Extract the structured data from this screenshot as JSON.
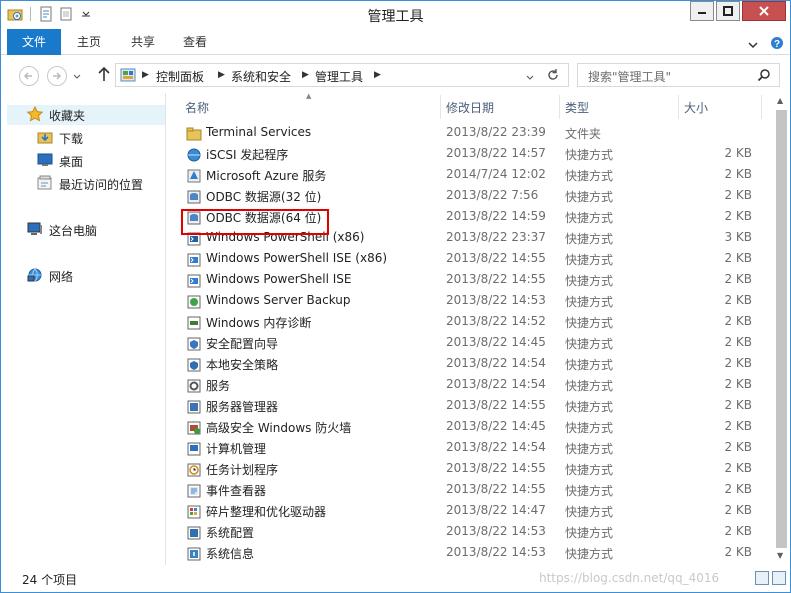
{
  "window": {
    "title": "管理工具"
  },
  "ribbon": {
    "tabs": [
      "文件",
      "主页",
      "共享",
      "查看"
    ]
  },
  "address": {
    "path": [
      "控制面板",
      "系统和安全",
      "管理工具"
    ],
    "search_placeholder": "搜索\"管理工具\""
  },
  "nav": {
    "favorites": "收藏夹",
    "downloads": "下载",
    "desktop": "桌面",
    "recent": "最近访问的位置",
    "this_pc": "这台电脑",
    "network": "网络"
  },
  "columns": {
    "name": "名称",
    "date": "修改日期",
    "type": "类型",
    "size": "大小"
  },
  "files": [
    {
      "name": "Terminal Services",
      "date": "2013/8/22 23:39",
      "type": "文件夹",
      "size": "",
      "icon": "folder-icon"
    },
    {
      "name": "iSCSI 发起程序",
      "date": "2013/8/22 14:57",
      "type": "快捷方式",
      "size": "2 KB",
      "icon": "iscsi-icon"
    },
    {
      "name": "Microsoft Azure 服务",
      "date": "2014/7/24 12:02",
      "type": "快捷方式",
      "size": "2 KB",
      "icon": "azure-icon"
    },
    {
      "name": "ODBC 数据源(32 位)",
      "date": "2013/8/22 7:56",
      "type": "快捷方式",
      "size": "2 KB",
      "icon": "odbc-icon"
    },
    {
      "name": "ODBC 数据源(64 位)",
      "date": "2013/8/22 14:59",
      "type": "快捷方式",
      "size": "2 KB",
      "icon": "odbc-icon"
    },
    {
      "name": "Windows PowerShell (x86)",
      "date": "2013/8/22 23:37",
      "type": "快捷方式",
      "size": "3 KB",
      "icon": "powershell-icon"
    },
    {
      "name": "Windows PowerShell ISE (x86)",
      "date": "2013/8/22 14:55",
      "type": "快捷方式",
      "size": "2 KB",
      "icon": "powershell-ise-icon"
    },
    {
      "name": "Windows PowerShell ISE",
      "date": "2013/8/22 14:55",
      "type": "快捷方式",
      "size": "2 KB",
      "icon": "powershell-ise-icon"
    },
    {
      "name": "Windows Server Backup",
      "date": "2013/8/22 14:53",
      "type": "快捷方式",
      "size": "2 KB",
      "icon": "backup-icon"
    },
    {
      "name": "Windows 内存诊断",
      "date": "2013/8/22 14:52",
      "type": "快捷方式",
      "size": "2 KB",
      "icon": "memory-diagnostic-icon"
    },
    {
      "name": "安全配置向导",
      "date": "2013/8/22 14:45",
      "type": "快捷方式",
      "size": "2 KB",
      "icon": "security-wizard-icon"
    },
    {
      "name": "本地安全策略",
      "date": "2013/8/22 14:54",
      "type": "快捷方式",
      "size": "2 KB",
      "icon": "security-policy-icon"
    },
    {
      "name": "服务",
      "date": "2013/8/22 14:54",
      "type": "快捷方式",
      "size": "2 KB",
      "icon": "services-icon"
    },
    {
      "name": "服务器管理器",
      "date": "2013/8/22 14:55",
      "type": "快捷方式",
      "size": "2 KB",
      "icon": "server-manager-icon"
    },
    {
      "name": "高级安全 Windows 防火墙",
      "date": "2013/8/22 14:45",
      "type": "快捷方式",
      "size": "2 KB",
      "icon": "firewall-icon"
    },
    {
      "name": "计算机管理",
      "date": "2013/8/22 14:54",
      "type": "快捷方式",
      "size": "2 KB",
      "icon": "computer-management-icon"
    },
    {
      "name": "任务计划程序",
      "date": "2013/8/22 14:55",
      "type": "快捷方式",
      "size": "2 KB",
      "icon": "task-scheduler-icon"
    },
    {
      "name": "事件查看器",
      "date": "2013/8/22 14:55",
      "type": "快捷方式",
      "size": "2 KB",
      "icon": "event-viewer-icon"
    },
    {
      "name": "碎片整理和优化驱动器",
      "date": "2013/8/22 14:47",
      "type": "快捷方式",
      "size": "2 KB",
      "icon": "defrag-icon"
    },
    {
      "name": "系统配置",
      "date": "2013/8/22 14:53",
      "type": "快捷方式",
      "size": "2 KB",
      "icon": "system-config-icon"
    },
    {
      "name": "系统信息",
      "date": "2013/8/22 14:53",
      "type": "快捷方式",
      "size": "2 KB",
      "icon": "system-info-icon"
    }
  ],
  "status": {
    "count": "24 个项目",
    "watermark": "https://blog.csdn.net/qq_4016"
  },
  "colors": {
    "accent": "#1979ca",
    "highlight_border": "#e00000",
    "close_button": "#c75050"
  }
}
